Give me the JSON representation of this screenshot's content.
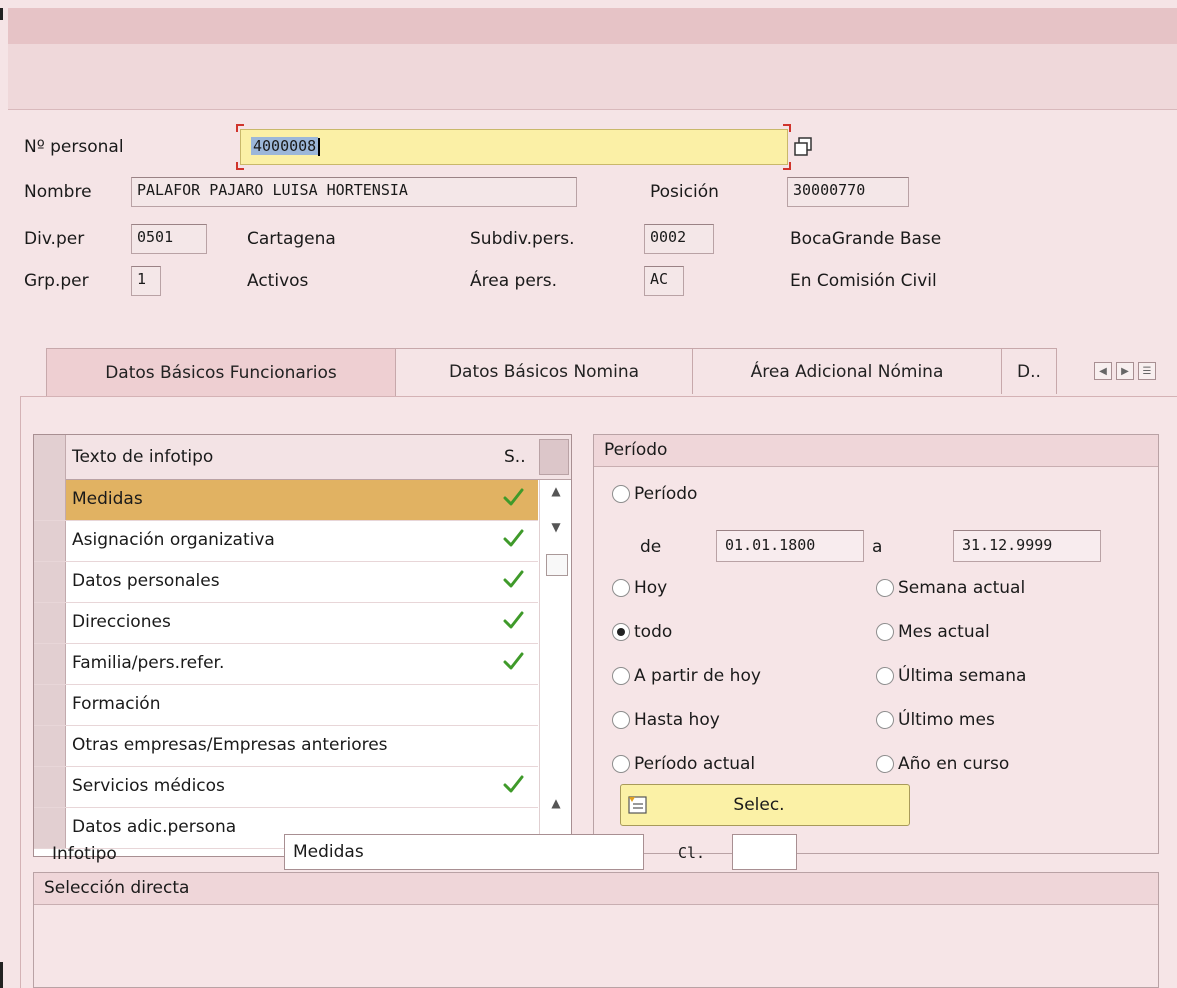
{
  "header": {
    "pers_label": "Nº personal",
    "pers_value": "4000008",
    "nombre_label": "Nombre",
    "nombre_value": "PALAFOR PAJARO LUISA HORTENSIA",
    "posicion_label": "Posición",
    "posicion_value": "30000770",
    "divper_label": "Div.per",
    "divper_value": "0501",
    "divper_text": "Cartagena",
    "subdiv_label": "Subdiv.pers.",
    "subdiv_value": "0002",
    "subdiv_text": "BocaGrande Base",
    "grpper_label": "Grp.per",
    "grpper_value": "1",
    "grpper_text": "Activos",
    "area_label": "Área pers.",
    "area_value": "AC",
    "area_text": "En Comisión Civil"
  },
  "tabs": [
    {
      "label": "Datos Básicos Funcionarios",
      "active": true
    },
    {
      "label": "Datos Básicos Nomina",
      "active": false
    },
    {
      "label": "Área Adicional Nómina",
      "active": false
    },
    {
      "label": "D..",
      "active": false
    }
  ],
  "infotype_table": {
    "col_text": "Texto de infotipo",
    "col_s": "S..",
    "rows": [
      {
        "text": "Medidas",
        "checked": true,
        "selected": true
      },
      {
        "text": "Asignación organizativa",
        "checked": true,
        "selected": false
      },
      {
        "text": "Datos personales",
        "checked": true,
        "selected": false
      },
      {
        "text": "Direcciones",
        "checked": true,
        "selected": false
      },
      {
        "text": "Familia/pers.refer.",
        "checked": true,
        "selected": false
      },
      {
        "text": "Formación",
        "checked": false,
        "selected": false
      },
      {
        "text": "Otras empresas/Empresas anteriores",
        "checked": false,
        "selected": false
      },
      {
        "text": "Servicios médicos",
        "checked": true,
        "selected": false
      },
      {
        "text": "Datos adic.persona",
        "checked": false,
        "selected": false
      }
    ]
  },
  "periodo": {
    "title": "Período",
    "periodo_label": "Período",
    "de_label": "de",
    "de_value": "01.01.1800",
    "a_label": "a",
    "a_value": "31.12.9999",
    "options_left": [
      "Hoy",
      "todo",
      "A partir de hoy",
      "Hasta hoy",
      "Período actual"
    ],
    "options_right": [
      "Semana actual",
      "Mes actual",
      "Última semana",
      "Último mes",
      "Año en curso"
    ],
    "selected": "todo",
    "select_button": "Selec."
  },
  "seleccion_directa": {
    "title": "Selección directa",
    "infotipo_label": "Infotipo",
    "infotipo_value": "Medidas",
    "cl_label": "Cl.",
    "cl_value": ""
  },
  "colors": {
    "selected_row": "#e1b262",
    "input_focus": "#fbf0a6",
    "check_green": "#3f9a2a"
  }
}
